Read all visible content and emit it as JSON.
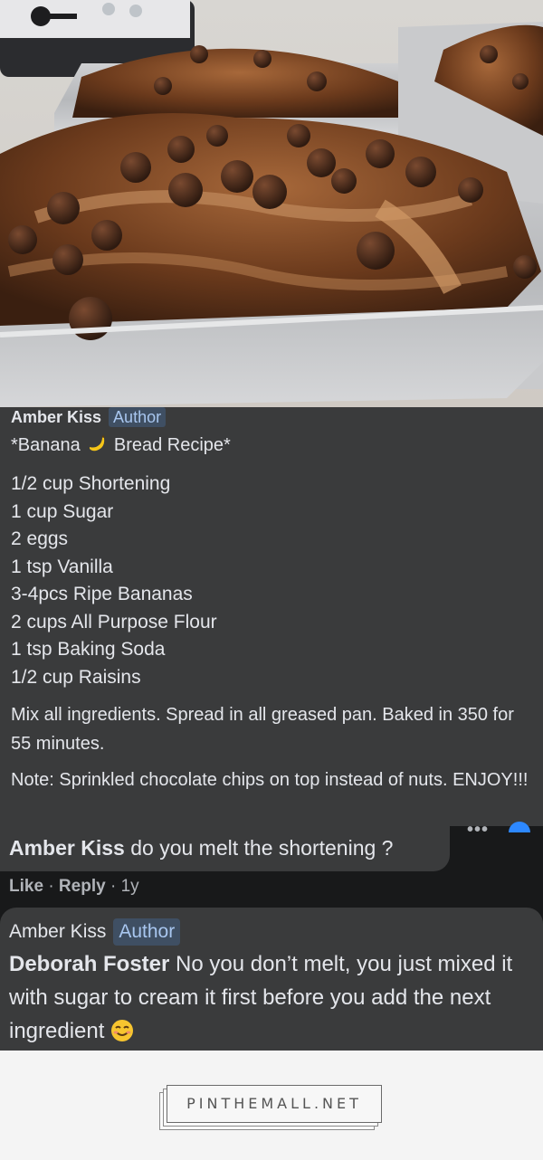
{
  "photo": {
    "icon": "banana-bread-photo"
  },
  "post": {
    "author": "Amber Kiss",
    "badge": "Author",
    "title_before": "*Banana",
    "title_after": "Bread Recipe*",
    "ingredients": [
      "1/2 cup Shortening",
      "1 cup Sugar",
      "2 eggs",
      "1 tsp Vanilla",
      "3-4pcs Ripe Bananas",
      "2 cups All Purpose Flour",
      "1 tsp Baking Soda",
      "1/2 cup Raisins"
    ],
    "instructions": "Mix all ingredients. Spread in all greased pan. Baked in 350 for 55 minutes.",
    "note": "Note: Sprinkled chocolate chips on top instead of nuts. ENJOY!!!"
  },
  "reply": {
    "mention": "Amber Kiss",
    "text": "do you melt the shortening ?",
    "more": "•••",
    "like": "Like",
    "separator": "·",
    "reply_label": "Reply",
    "time": "1y"
  },
  "reply2": {
    "author": "Amber Kiss",
    "badge": "Author",
    "mention": "Deborah Foster",
    "text": "No you don’t melt, you just mixed it with sugar to cream it first before you add the next ingredient"
  },
  "footer": {
    "logo": "PINTHEMALL.NET"
  },
  "colors": {
    "bubble": "#3a3b3c",
    "text": "#e4e6eb",
    "badge_bg": "#3f4f63",
    "badge_text": "#a8c6ef",
    "muted": "#b0b3b8",
    "accent": "#2d88ff"
  }
}
